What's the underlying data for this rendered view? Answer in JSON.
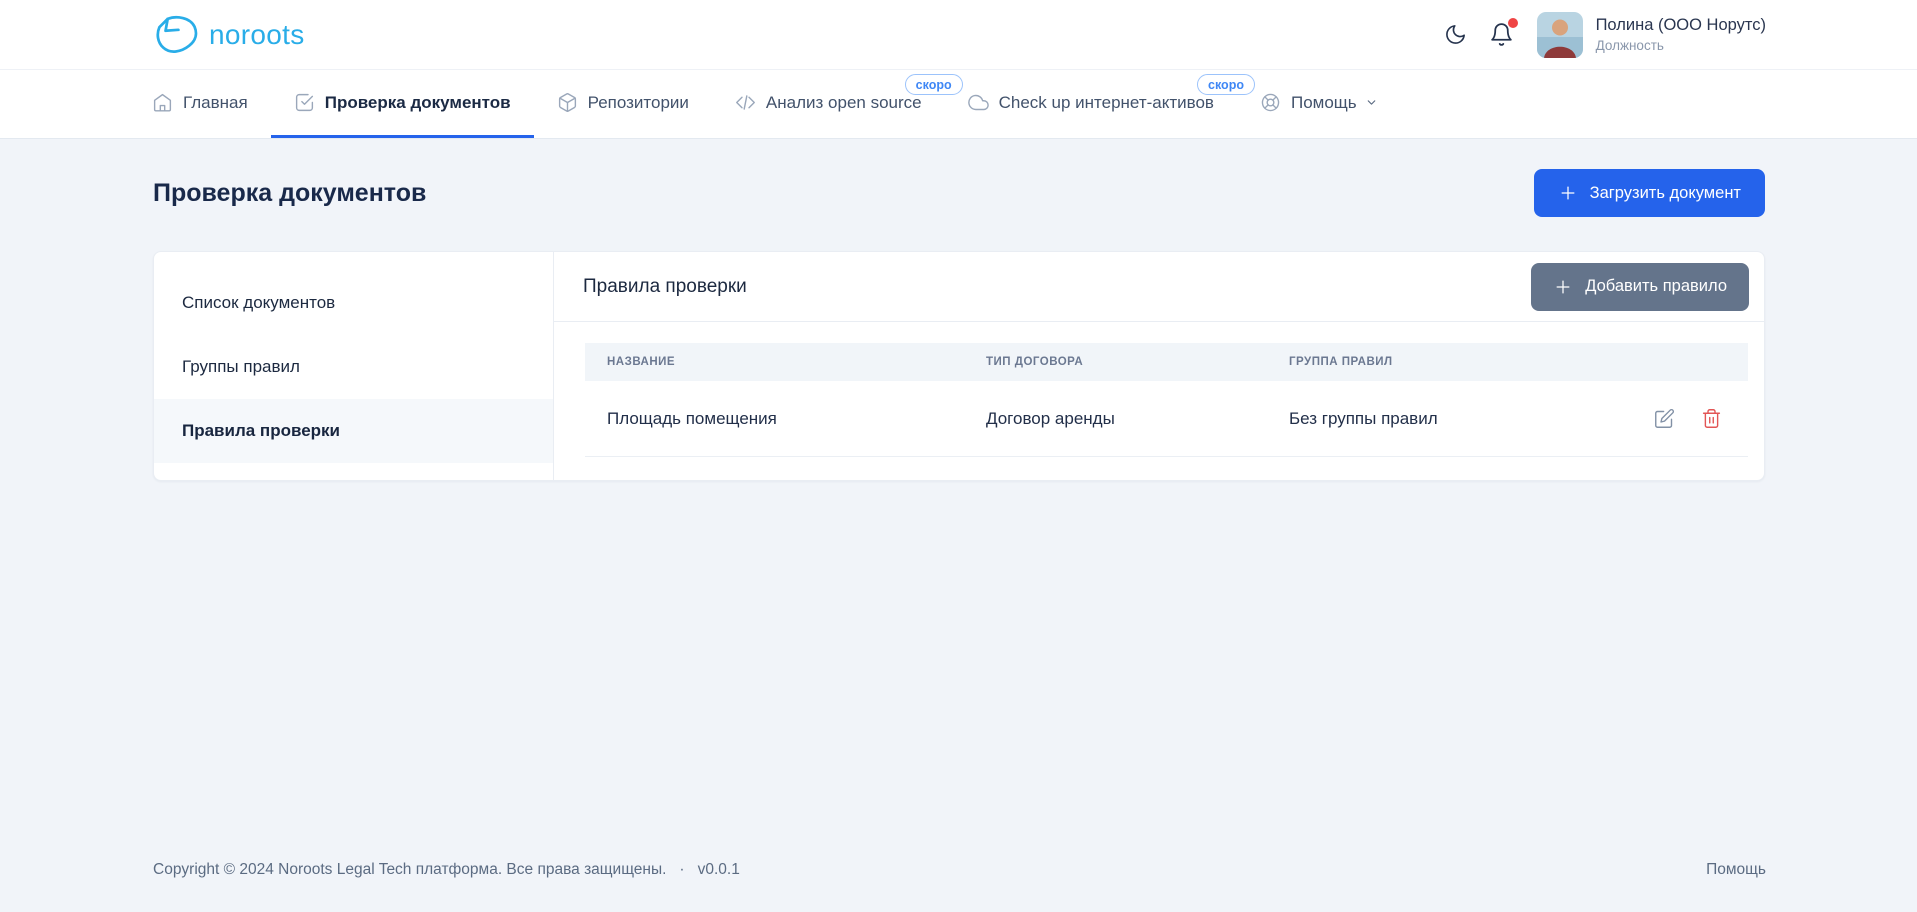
{
  "brand": {
    "name": "noroots"
  },
  "header": {
    "user": {
      "name": "Полина (ООО Норутс)",
      "role": "Должность"
    }
  },
  "nav": {
    "soon_label": "скоро",
    "items": [
      {
        "label": "Главная",
        "icon": "home",
        "active": false
      },
      {
        "label": "Проверка документов",
        "icon": "check-square",
        "active": true
      },
      {
        "label": "Репозитории",
        "icon": "package",
        "active": false
      },
      {
        "label": "Анализ open source",
        "icon": "code",
        "soon": true
      },
      {
        "label": "Check up интернет-активов",
        "icon": "cloud",
        "soon": true
      },
      {
        "label": "Помощь",
        "icon": "life-buoy",
        "dropdown": true
      }
    ]
  },
  "page": {
    "title": "Проверка документов",
    "upload_button": "Загрузить документ"
  },
  "sidebar": {
    "items": [
      {
        "label": "Список документов",
        "active": false
      },
      {
        "label": "Группы правил",
        "active": false
      },
      {
        "label": "Правила проверки",
        "active": true
      }
    ]
  },
  "panel": {
    "title": "Правила проверки",
    "add_button": "Добавить правило",
    "table": {
      "columns": [
        "НАЗВАНИЕ",
        "ТИП ДОГОВОРА",
        "ГРУППА ПРАВИЛ"
      ],
      "rows": [
        {
          "name": "Площадь помещения",
          "contract_type": "Договор аренды",
          "rule_group": "Без группы правил"
        }
      ],
      "row_actions": [
        "edit",
        "delete"
      ]
    }
  },
  "footer": {
    "copyright": "Copyright © 2024 Noroots Legal Tech платформа. Все права защищены.",
    "separator": "·",
    "version": "v0.0.1",
    "help": "Помощь"
  },
  "colors": {
    "brand": "#29ade8",
    "primary": "#2563eb",
    "secondary_button": "#64748b",
    "danger": "#e25555",
    "soon_badge": "#3f87f5",
    "page_bg": "#f1f4f9"
  },
  "icons": {
    "theme_toggle": "moon",
    "notifications": "bell-with-red-dot",
    "nav": [
      "home",
      "check-square",
      "package",
      "code",
      "cloud",
      "life-buoy"
    ],
    "buttons": "plus",
    "row_actions": [
      "pencil-edit",
      "trash"
    ]
  }
}
